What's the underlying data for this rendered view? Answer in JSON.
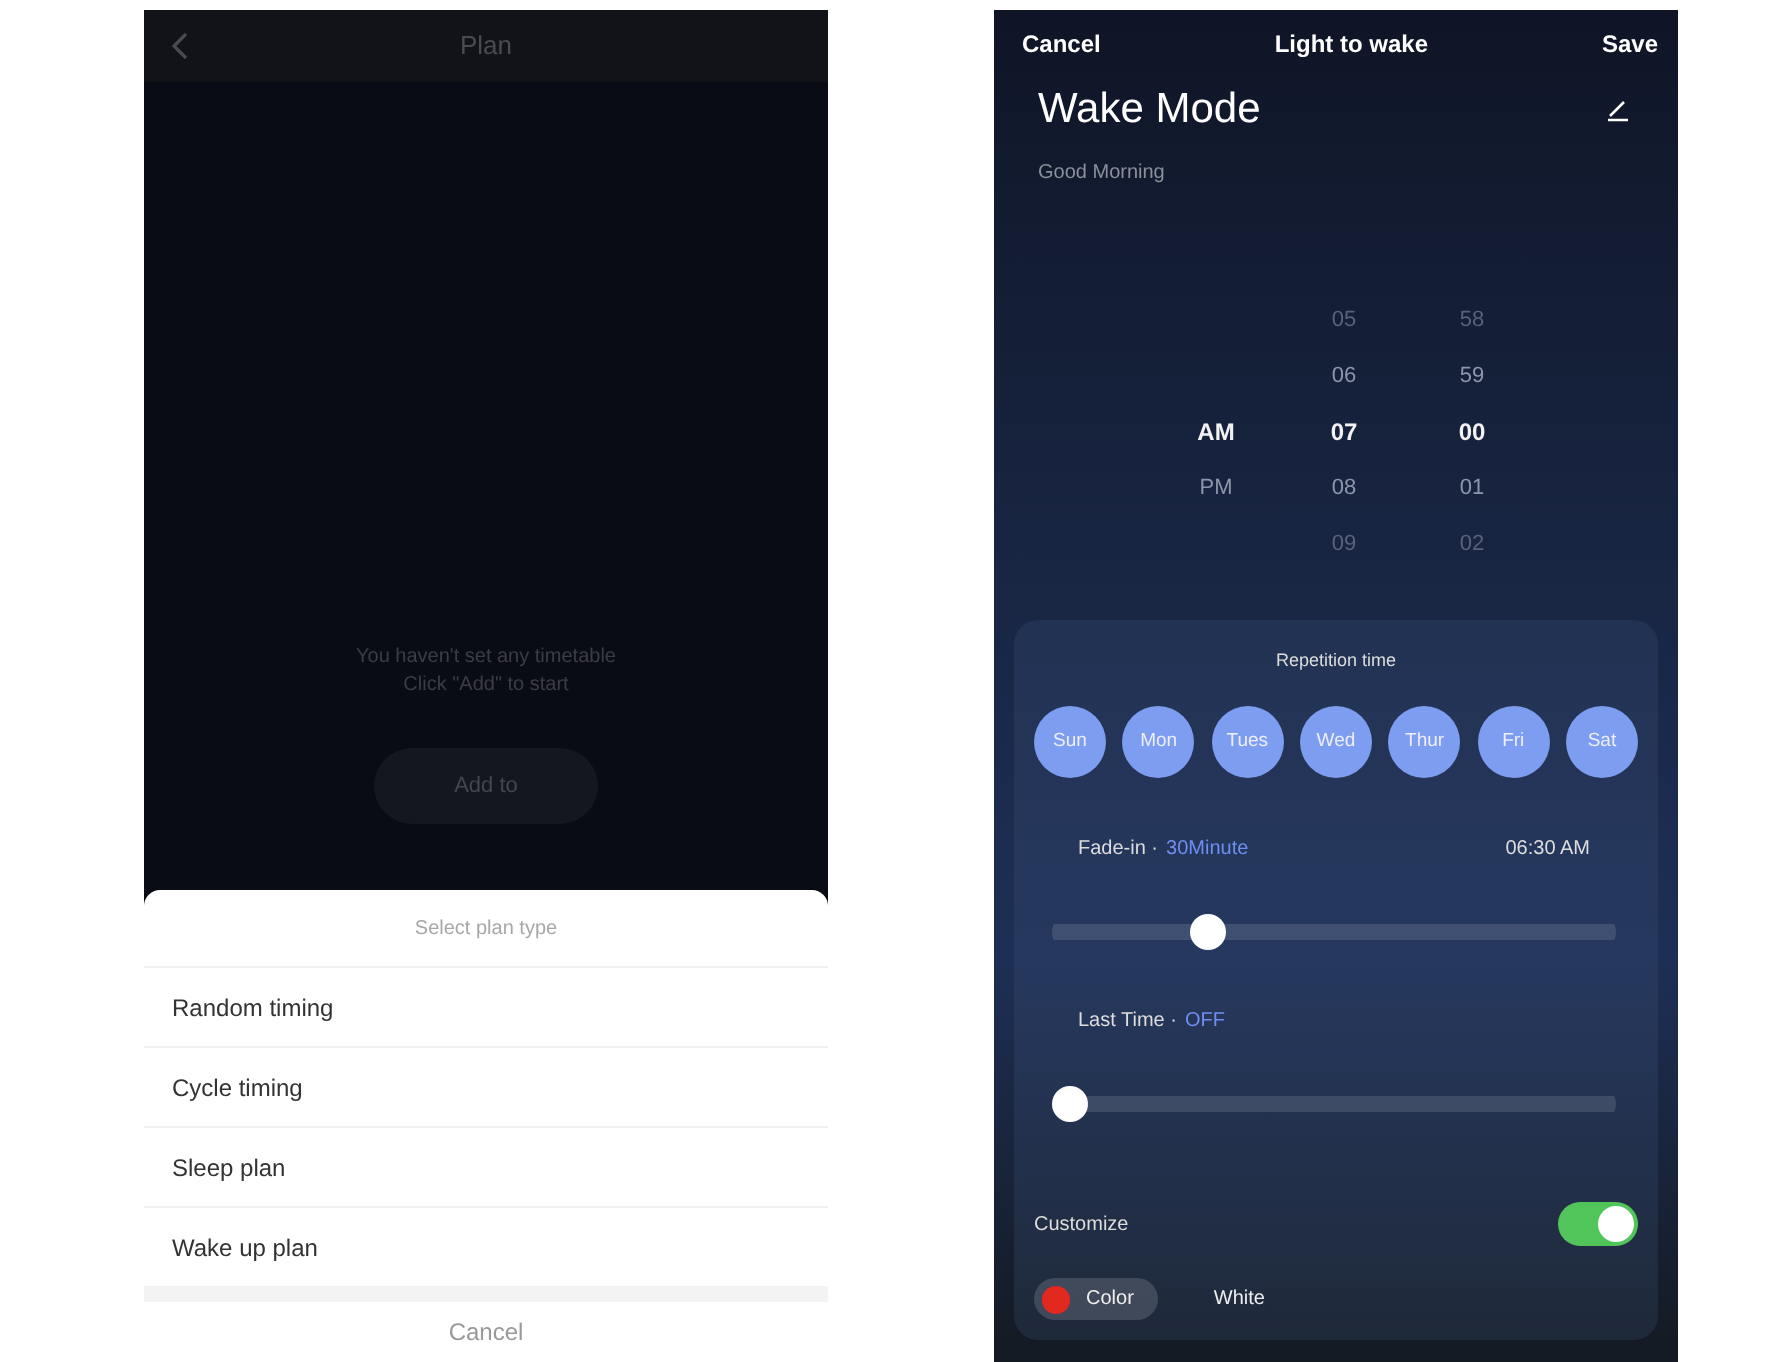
{
  "left_screen": {
    "header": {
      "title": "Plan"
    },
    "empty_message": [
      "You haven't set any timetable",
      "Click \"Add\" to start"
    ],
    "add_button": "Add to",
    "plan_type_sheet": {
      "title": "Select plan type",
      "options": [
        "Random timing",
        "Cycle timing",
        "Sleep plan",
        "Wake up plan"
      ],
      "cancel": "Cancel"
    }
  },
  "right_screen": {
    "header": {
      "cancel": "Cancel",
      "title": "Light to wake",
      "save": "Save"
    },
    "mode_title": "Wake Mode",
    "subtitle": "Good Morning",
    "time_picker": {
      "period": [
        {
          "label": "AM",
          "selected": true
        },
        {
          "label": "PM",
          "selected": false
        }
      ],
      "hours": [
        {
          "label": "05",
          "selected": false
        },
        {
          "label": "06",
          "selected": false
        },
        {
          "label": "07",
          "selected": true
        },
        {
          "label": "08",
          "selected": false
        },
        {
          "label": "09",
          "selected": false
        }
      ],
      "minutes": [
        {
          "label": "58",
          "selected": false
        },
        {
          "label": "59",
          "selected": false
        },
        {
          "label": "00",
          "selected": true
        },
        {
          "label": "01",
          "selected": false
        },
        {
          "label": "02",
          "selected": false
        }
      ]
    },
    "repetition": {
      "title": "Repetition time",
      "days": [
        {
          "label": "Sun",
          "selected": true
        },
        {
          "label": "Mon",
          "selected": true
        },
        {
          "label": "Tues",
          "selected": true
        },
        {
          "label": "Wed",
          "selected": true
        },
        {
          "label": "Thur",
          "selected": true
        },
        {
          "label": "Fri",
          "selected": true
        },
        {
          "label": "Sat",
          "selected": true
        }
      ]
    },
    "fade_in": {
      "label": "Fade-in ·",
      "value": "30Minute",
      "time": "06:30 AM",
      "level": 0.26
    },
    "last_time": {
      "label": "Last Time ·",
      "value": "OFF",
      "level": 0
    },
    "customize": {
      "label": "Customize",
      "on": true
    },
    "light_modes": [
      {
        "label": "Color",
        "selected": true,
        "color": "#e3281e"
      },
      {
        "label": "White",
        "selected": false
      }
    ]
  }
}
